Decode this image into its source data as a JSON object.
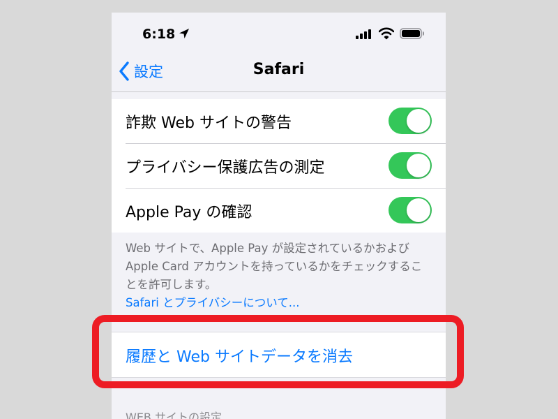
{
  "status_bar": {
    "time": "6:18",
    "icons": [
      "location-arrow-icon",
      "cellular-signal-icon",
      "wifi-icon",
      "battery-icon"
    ]
  },
  "nav": {
    "back_label": "設定",
    "title": "Safari"
  },
  "settings": [
    {
      "label": "詐欺 Web サイトの警告",
      "enabled": true
    },
    {
      "label": "プライバシー保護広告の測定",
      "enabled": true
    },
    {
      "label": "Apple Pay の確認",
      "enabled": true
    }
  ],
  "footer": {
    "text": "Web サイトで、Apple Pay が設定されているかおよび Apple Card アカウントを持っているかをチェックすることを許可します。",
    "link": "Safari とプライバシーについて..."
  },
  "clear_history": {
    "label": "履歴と Web サイトデータを消去"
  },
  "next_section": {
    "header": "WEB サイトの設定"
  },
  "colors": {
    "accent": "#0a7aff",
    "toggle_on": "#34c759",
    "highlight": "#ed1c24",
    "background": "#f2f2f7"
  }
}
